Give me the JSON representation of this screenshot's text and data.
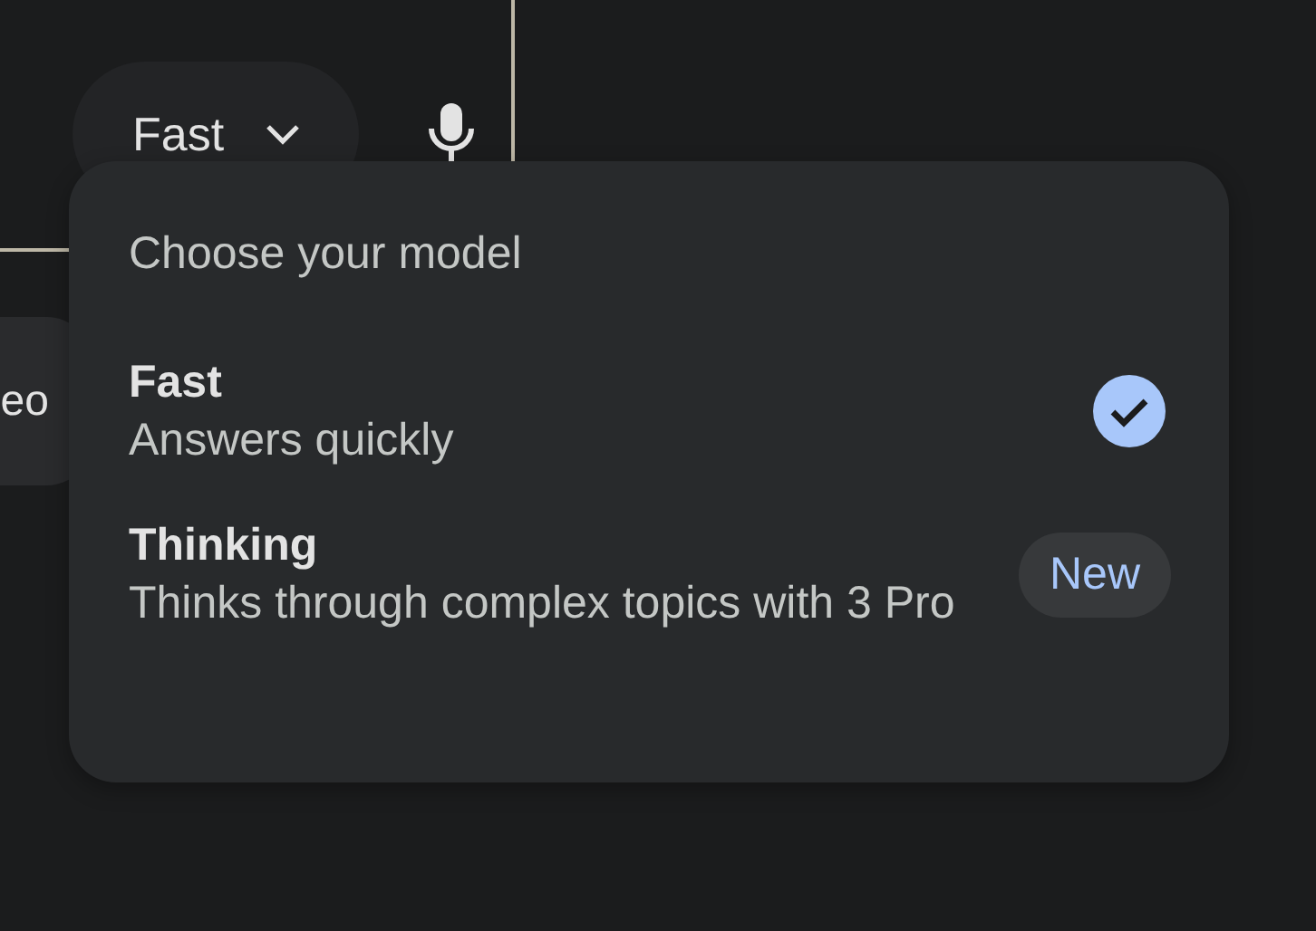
{
  "composer": {
    "model_button": {
      "label": "Fast"
    }
  },
  "side_chip": {
    "label": "eo"
  },
  "model_menu": {
    "title": "Choose your model",
    "options": [
      {
        "name": "Fast",
        "description": "Answers quickly",
        "selected": true
      },
      {
        "name": "Thinking",
        "description": "Thinks through complex topics with 3 Pro",
        "selected": false,
        "badge": "New"
      }
    ]
  }
}
